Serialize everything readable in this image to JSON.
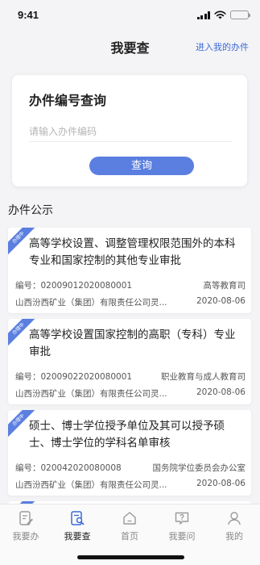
{
  "status_bar": {
    "time": "9:41"
  },
  "nav": {
    "title": "我要查",
    "right_link": "进入我的办件"
  },
  "query": {
    "title": "办件编号查询",
    "placeholder": "请输入办件编码",
    "button_label": "查询"
  },
  "section": {
    "title": "办件公示"
  },
  "records": [
    {
      "status": "办理中",
      "title": "高等学校设置、调整管理权限范围外的本科专业和国家控制的其他专业审批",
      "number": "编号：02009012020080001",
      "department": "高等教育司",
      "applicant": "山西汾西矿业（集团）有限责任公司灵...",
      "date": "2020-08-06"
    },
    {
      "status": "办理中",
      "title": "高等学校设置国家控制的高职（专科）专业审批",
      "number": "编号：02009022020080001",
      "department": "职业教育与成人教育司",
      "applicant": "山西汾西矿业（集团）有限责任公司灵...",
      "date": "2020-08-06"
    },
    {
      "status": "办理中",
      "title": "硕士、博士学位授予单位及其可以授予硕士、博士学位的学科名单审核",
      "number": "编号：020042020080008",
      "department": "国务院学位委员会办公室",
      "applicant": "山西汾西矿业（集团）有限责任公司灵...",
      "date": "2020-08-06"
    }
  ],
  "tabs": [
    {
      "label": "我要办",
      "icon": "edit-document-icon",
      "active": false
    },
    {
      "label": "我要查",
      "icon": "search-document-icon",
      "active": true
    },
    {
      "label": "首页",
      "icon": "home-icon",
      "active": false
    },
    {
      "label": "我要问",
      "icon": "question-chat-icon",
      "active": false
    },
    {
      "label": "我的",
      "icon": "user-icon",
      "active": false
    }
  ],
  "colors": {
    "accent": "#5b7fe0",
    "link": "#3d6ad6",
    "background": "#f4f4f6"
  }
}
